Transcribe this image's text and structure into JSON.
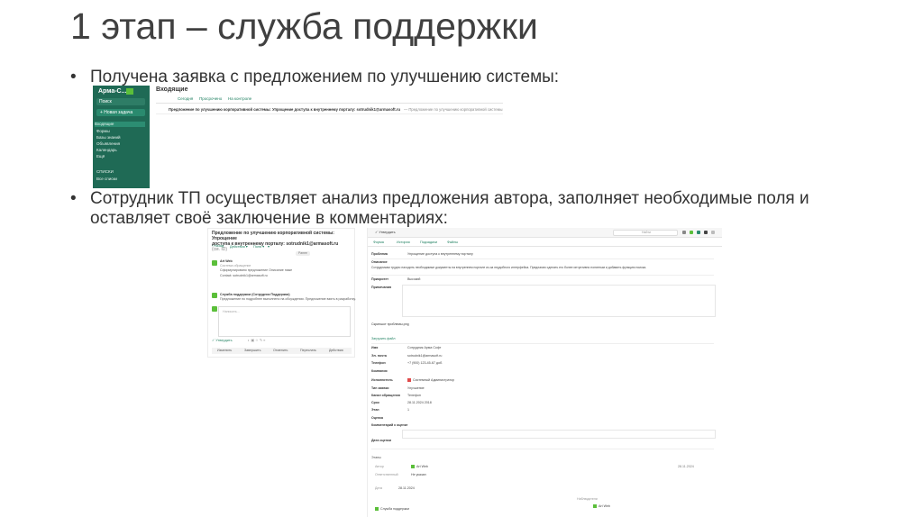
{
  "slide": {
    "title": "1 этап – служба поддержки",
    "bullets": [
      {
        "marker": "•",
        "text": "Получена заявка с предложением по улучшению системы:"
      },
      {
        "marker": "•",
        "text": "Сотрудник ТП осуществляет анализ предложения автора, заполняет необходимые поля и"
      },
      {
        "marker": "",
        "text": "оставляет своё заключение в комментариях:"
      }
    ]
  },
  "screenshot1": {
    "app_name": "Арма-С...",
    "search_placeholder": "Поиск",
    "new_task": "+ Новая задача",
    "nav": [
      "Входящие",
      "Формы",
      "Базы знаний",
      "Объявления",
      "Календарь",
      "Ещё"
    ],
    "lists_header": "СПИСКИ",
    "lists_item": "Все списки",
    "heading": "Входящие",
    "tabs": [
      "Сегодня",
      "Просрочено",
      "На контроле"
    ],
    "row_subject": "Предложение по улучшению корпоративной системы: Упрощение доступа к внутреннему порталу: sotrudnik1@armasoft.ru",
    "row_snippet": "— Предложение по улучшению корпоративной системы"
  },
  "screenshot2": {
    "left": {
      "title_line1": "Предложение по улучшению корпоративной системы: Упрощение",
      "title_line2": "доступа к внутреннему порталу: sotrudnik1@armasoft.ru",
      "title_suffix": "(см. ID)",
      "tools": [
        "‹ Назад",
        "Действия ▾",
        "Поля ▾",
        "▾"
      ],
      "pill": "Ранее",
      "comment1_author": "Art Web",
      "comment1_meta": "Система обращение",
      "comment1_line1": "Сформулировано предложение Описание ниже",
      "comment1_line2": "Contact: sotrudnik1@armasoft.ru",
      "comment2_author": "Служба поддержки (Сотрудник Поддержки)",
      "comment2_text": "Предложение по подробнее выполнено на обсуждении. Предложение взять в разработку.",
      "input_placeholder": "Написать...",
      "send_label": "✓ Утвердить",
      "bottom_actions": [
        "Изменить",
        "Завершить",
        "Отменить",
        "Переслать",
        "Действия"
      ]
    },
    "right": {
      "action": "✓ Утвердить",
      "search": "Найти",
      "tabs": [
        "Форма",
        "История",
        "Подзадачи",
        "Файлы"
      ],
      "fields": [
        {
          "label": "Проблема",
          "value": "Упрощение доступа к внутреннему порталу"
        },
        {
          "label": "Описание",
          "value": "Сотрудникам трудно находить необходимые документы на внутреннем портале из-за неудобного интерфейса. Предлагаю сделать его более интуитивно понятным и добавить функцию поиска."
        },
        {
          "label": "Приоритет",
          "value": "Высокий"
        },
        {
          "label": "Примечания",
          "value": ""
        },
        {
          "label": "Скриншот проблемы.png",
          "value": ""
        },
        {
          "label": "Загрузить файл",
          "value": ""
        },
        {
          "label": "Имя",
          "value": "Сотрудник Арма Софт"
        },
        {
          "label": "Эл. почта",
          "value": "sotrudnik1@armasoft.ru"
        },
        {
          "label": "Телефон",
          "value": "+7 (900) 123-45-67  доб."
        },
        {
          "label": "Компания",
          "value": ""
        },
        {
          "label": "Исполнитель",
          "value": "Системный Администратор"
        },
        {
          "label": "Тип заявки",
          "value": "Улучшение"
        },
        {
          "label": "Канал обращения",
          "value": "Телефон"
        },
        {
          "label": "Срок",
          "value": "28.11.2024 2018"
        },
        {
          "label": "Этап",
          "value": "1"
        },
        {
          "label": "Оценка",
          "value": ""
        },
        {
          "label": "Комментарий к оценке",
          "value": ""
        },
        {
          "label": "Дата оценки",
          "value": ""
        }
      ],
      "sections": [
        {
          "label": "Этапы",
          "value": ""
        },
        {
          "label": "Автор",
          "value": "Art Web"
        },
        {
          "label": "Ответственный",
          "value": "Не указан"
        },
        {
          "label": "Дата",
          "value": "28.11.2024"
        },
        {
          "label": "Наблюдатели",
          "value": "Art Web"
        },
        {
          "label": "Служба поддержки",
          "value": "Служба поддержки"
        }
      ],
      "date_right": "28.11.2024"
    }
  },
  "colors": {
    "sidebar": "#1f6a55",
    "accent": "#5bbf3a",
    "link": "#1d7f5f",
    "title": "#404040"
  }
}
